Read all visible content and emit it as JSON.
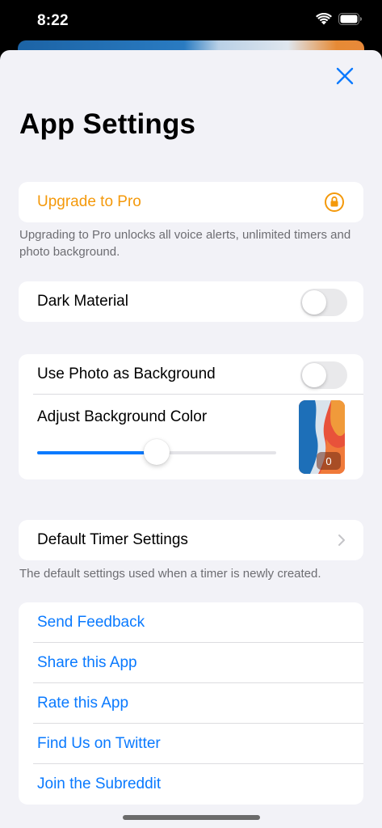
{
  "status_bar": {
    "time": "8:22"
  },
  "sheet": {
    "title": "App Settings",
    "close_icon": "close-icon"
  },
  "upgrade": {
    "label": "Upgrade to Pro",
    "icon": "lock-icon",
    "footnote": "Upgrading to Pro unlocks all voice alerts, unlimited timers and photo background."
  },
  "dark_material": {
    "label": "Dark Material",
    "enabled": false
  },
  "background": {
    "use_photo_label": "Use Photo as Background",
    "use_photo_enabled": false,
    "adjust_label": "Adjust Background Color",
    "slider_value": 0.5,
    "preview_badge": "0"
  },
  "timer": {
    "label": "Default Timer Settings",
    "footnote": "The default settings used when a timer is newly created."
  },
  "links": [
    {
      "label": "Send Feedback"
    },
    {
      "label": "Share this App"
    },
    {
      "label": "Rate this App"
    },
    {
      "label": "Find Us on Twitter"
    },
    {
      "label": "Join the Subreddit"
    }
  ],
  "colors": {
    "accent": "#0a7aff",
    "pro": "#f4990b",
    "background": "#f2f2f7"
  }
}
